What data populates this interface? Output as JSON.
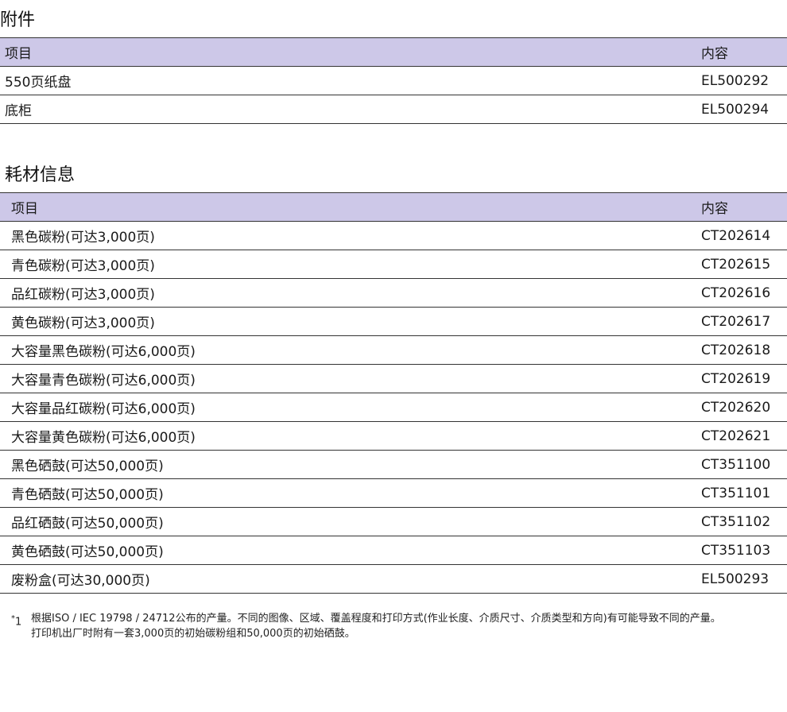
{
  "accessories": {
    "title": "附件",
    "headers": [
      "项目",
      "内容"
    ],
    "rows": [
      [
        "550页纸盘",
        "EL500292"
      ],
      [
        "底柜",
        "EL500294"
      ]
    ]
  },
  "supplies": {
    "title": "耗材信息",
    "headers": [
      "项目",
      "内容"
    ],
    "rows": [
      [
        "黑色碳粉(可达3,000页)",
        "CT202614"
      ],
      [
        "青色碳粉(可达3,000页)",
        "CT202615"
      ],
      [
        "品红碳粉(可达3,000页)",
        "CT202616"
      ],
      [
        "黄色碳粉(可达3,000页)",
        "CT202617"
      ],
      [
        "大容量黑色碳粉(可达6,000页)",
        "CT202618"
      ],
      [
        "大容量青色碳粉(可达6,000页)",
        "CT202619"
      ],
      [
        "大容量品红碳粉(可达6,000页)",
        "CT202620"
      ],
      [
        "大容量黄色碳粉(可达6,000页)",
        "CT202621"
      ],
      [
        "黑色硒鼓(可达50,000页)",
        "CT351100"
      ],
      [
        "青色硒鼓(可达50,000页)",
        "CT351101"
      ],
      [
        "品红硒鼓(可达50,000页)",
        "CT351102"
      ],
      [
        "黄色硒鼓(可达50,000页)",
        "CT351103"
      ],
      [
        "废粉盒(可达30,000页)",
        "EL500293"
      ]
    ]
  },
  "footnote": {
    "marker_star": "*",
    "marker_num": "1",
    "line1": "根据ISO / IEC 19798 / 24712公布的产量。不同的图像、区域、覆盖程度和打印方式(作业长度、介质尺寸、介质类型和方向)有可能导致不同的产量。",
    "line2": "打印机出厂时附有一套3,000页的初始碳粉组和50,000页的初始硒鼓。"
  },
  "colors": {
    "header_bg": "#cdc8e8",
    "rule": "#333333"
  }
}
